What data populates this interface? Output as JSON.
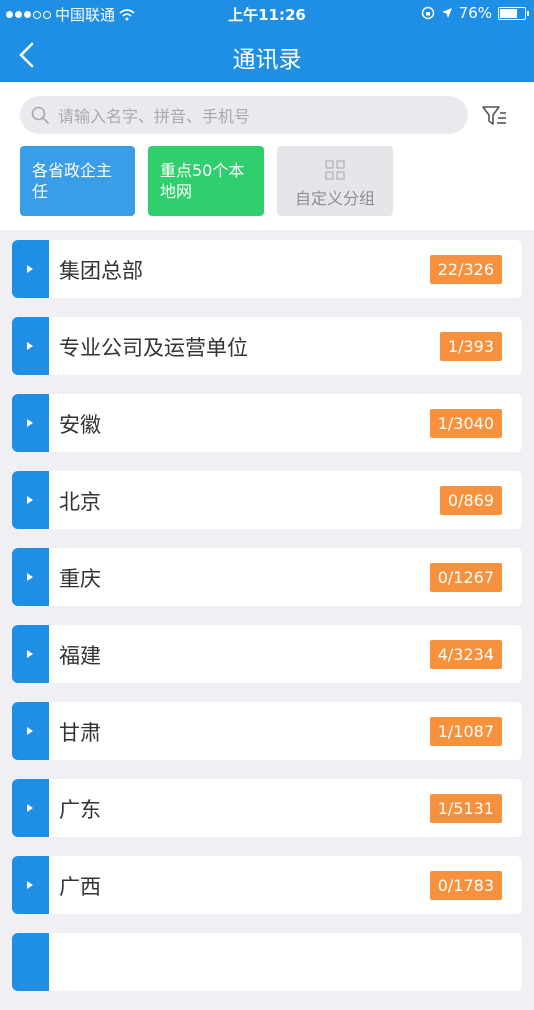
{
  "status_bar": {
    "carrier": "中国联通",
    "time": "上午11:26",
    "battery": "76%",
    "battery_level": 0.76
  },
  "nav": {
    "title": "通讯录"
  },
  "search": {
    "placeholder": "请输入名字、拼音、手机号"
  },
  "quick_groups": [
    {
      "label": "各省政企主任",
      "color": "#3a9de8"
    },
    {
      "label": "重点50个本地网",
      "color": "#2fcf6d"
    },
    {
      "label": "自定义分组",
      "color": "#e5e5ea"
    }
  ],
  "items": [
    {
      "name": "集团总部",
      "count": "22/326"
    },
    {
      "name": "专业公司及运营单位",
      "count": "1/393"
    },
    {
      "name": "安徽",
      "count": "1/3040"
    },
    {
      "name": "北京",
      "count": "0/869"
    },
    {
      "name": "重庆",
      "count": "0/1267"
    },
    {
      "name": "福建",
      "count": "4/3234"
    },
    {
      "name": "甘肃",
      "count": "1/1087"
    },
    {
      "name": "广东",
      "count": "1/5131"
    },
    {
      "name": "广西",
      "count": "0/1783"
    },
    {
      "name": "",
      "count": ""
    }
  ],
  "colors": {
    "primary": "#1f8fe5",
    "badge": "#f7913d",
    "background": "#efeff4"
  }
}
